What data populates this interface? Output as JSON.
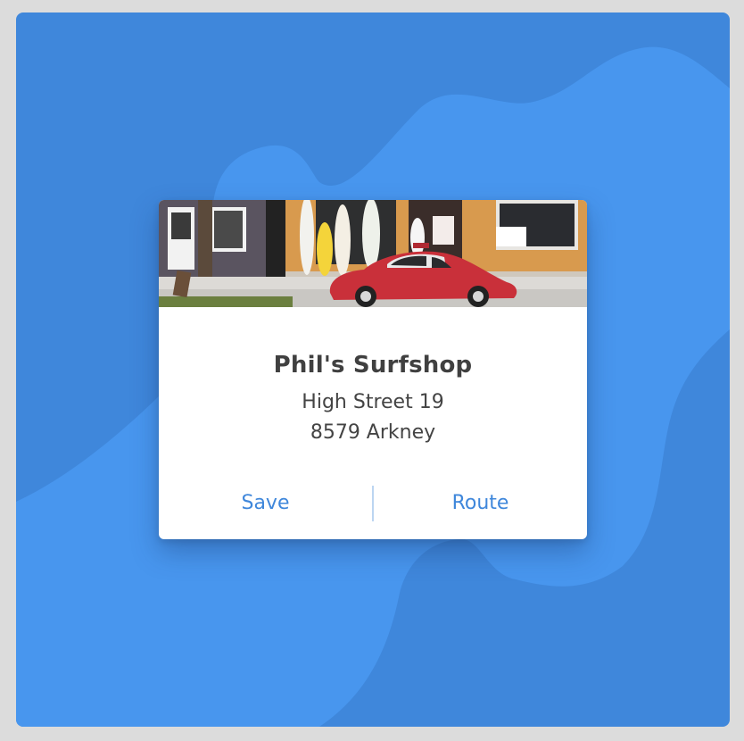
{
  "card": {
    "image": "surf-shop-photo-with-red-beetle",
    "title": "Phil's Surfshop",
    "address_line1": "High Street 19",
    "address_line2": "8579 Arkney"
  },
  "actions": {
    "save_label": "Save",
    "route_label": "Route"
  },
  "colors": {
    "background": "#3f87db",
    "blob": "#4896ee",
    "accent": "#3f87db",
    "card": "#ffffff",
    "title": "#404040"
  }
}
